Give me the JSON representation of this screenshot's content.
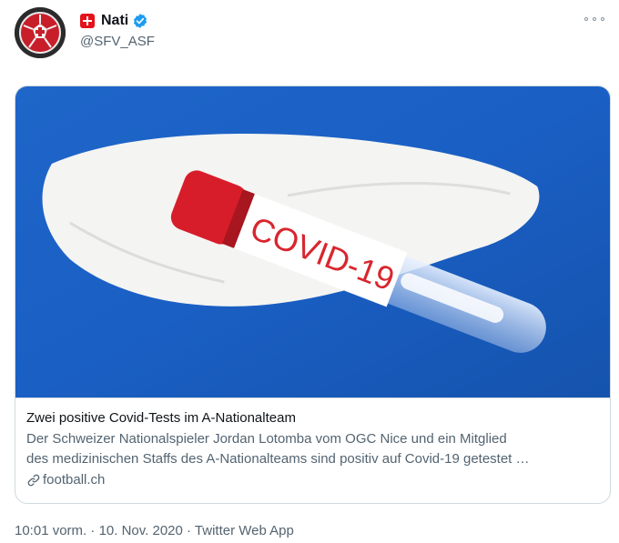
{
  "tweet": {
    "display_name": "Nati",
    "handle": "@SFV_ASF",
    "icons": {
      "flag": "swiss-flag-icon",
      "verified": "verified-badge-icon",
      "more": "more-options-icon"
    }
  },
  "card": {
    "image_label": "COVID-19",
    "title": "Zwei positive Covid-Tests im A-Nationalteam",
    "description_line1": "Der Schweizer Nationalspieler Jordan Lotomba vom OGC Nice und ein Mitglied",
    "description_line2": "des medizinischen Staffs des A-Nationalteams sind positiv auf Covid-19 getestet …",
    "domain": "football.ch",
    "domain_icon": "link-icon"
  },
  "meta": {
    "time": "10:01 vorm.",
    "sep1": " · ",
    "date": "10. Nov. 2020",
    "sep2": " · ",
    "app": "Twitter Web App"
  },
  "colors": {
    "accent": "#1d9bf0",
    "flag_red": "#e4121a",
    "secondary_text": "#536471"
  }
}
